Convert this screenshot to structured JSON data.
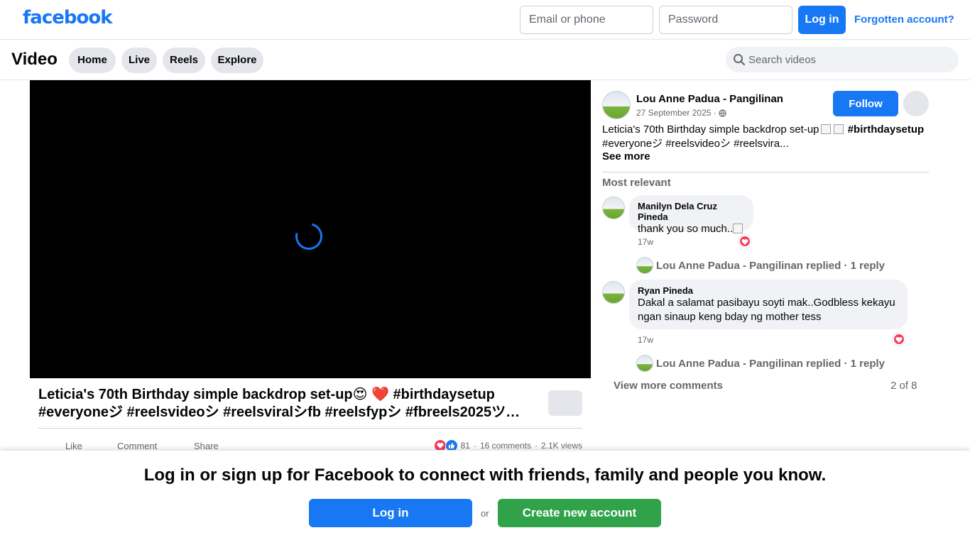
{
  "header": {
    "logo": "facebook",
    "email_placeholder": "Email or phone",
    "password_placeholder": "Password",
    "login_label": "Log in",
    "forgot_label": "Forgotten account?"
  },
  "nav": {
    "title": "Video",
    "tabs": [
      "Home",
      "Live",
      "Reels",
      "Explore"
    ],
    "search_placeholder": "Search videos"
  },
  "video": {
    "title_line1": "Leticia's 70th Birthday simple backdrop set-up😍 ❤️ #birthdaysetup",
    "title_line2": "#everyoneジ #reelsvideoシ #reelsviralシfb #reelsfypシ #fbreels2025ツ…",
    "actions": {
      "like": "Like",
      "comment": "Comment",
      "share": "Share"
    },
    "stats": {
      "reactions": "81",
      "comments": "16 comments",
      "views": "2.1K views"
    }
  },
  "post": {
    "author": "Lou Anne Padua - Pangilinan",
    "date": "27 September 2025 ·",
    "follow_label": "Follow",
    "caption_start": "Leticia's 70th Birthday simple backdrop set-up",
    "caption_tag1": "#birthdaysetup",
    "caption_line2": "#everyoneジ #reelsvideoシ #reelsvira...",
    "see_more": "See more",
    "sort_label": "Most relevant"
  },
  "comments": [
    {
      "name": "Manilyn Dela Cruz Pineda",
      "text": "thank you so much..",
      "time": "17w",
      "reply": "Lou Anne Padua - Pangilinan replied · 1 reply"
    },
    {
      "name": "Ryan Pineda",
      "text_line1": "Dakal a salamat pasibayu soyti mak..Godbless kekayu",
      "text_line2": "ngan sinaup keng bday ng mother tess",
      "time": "17w",
      "reply": "Lou Anne Padua - Pangilinan replied · 1 reply"
    }
  ],
  "comments_footer": {
    "view_more": "View more comments",
    "page_count": "2 of 8"
  },
  "banner": {
    "text": "Log in or sign up for Facebook to connect with friends, family and people you know.",
    "login_label": "Log in",
    "or": "or",
    "create_label": "Create new account"
  },
  "colors": {
    "brand": "#1877f2",
    "create_green": "#2fa24a",
    "love": "#f33e58"
  },
  "icons": [
    "search-icon",
    "globe-icon",
    "love-reaction-icon",
    "like-reaction-icon",
    "loading-spinner-icon"
  ]
}
